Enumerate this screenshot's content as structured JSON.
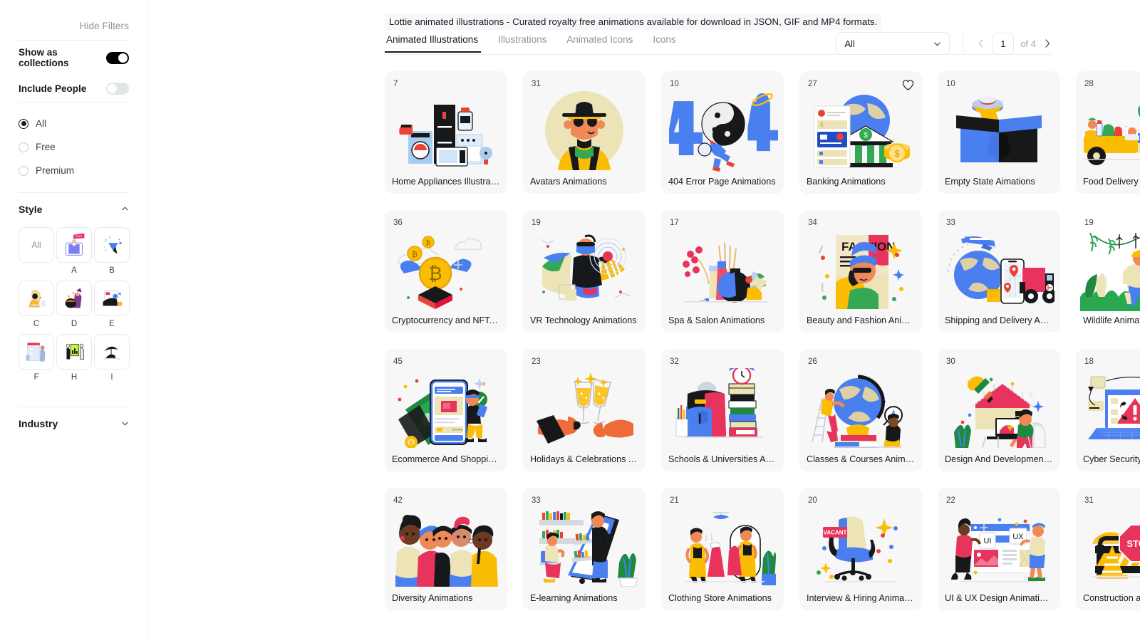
{
  "sidebar": {
    "hide_filters": "Hide Filters",
    "toggles": [
      {
        "label": "Show as collections",
        "state": "on"
      },
      {
        "label": "Include People",
        "state": "off"
      }
    ],
    "price_options": [
      {
        "label": "All",
        "selected": true
      },
      {
        "label": "Free",
        "selected": false
      },
      {
        "label": "Premium",
        "selected": false
      }
    ],
    "style": {
      "title": "Style",
      "chevron": "chevron-up-icon",
      "items": [
        {
          "label": "",
          "thumb": "all",
          "caption": ""
        },
        {
          "label": "A",
          "thumb": "style-a",
          "caption": "A"
        },
        {
          "label": "B",
          "thumb": "style-b",
          "caption": "B"
        },
        {
          "label": "C",
          "thumb": "style-c",
          "caption": "C"
        },
        {
          "label": "D",
          "thumb": "style-d",
          "caption": "D"
        },
        {
          "label": "E",
          "thumb": "style-e",
          "caption": "E"
        },
        {
          "label": "F",
          "thumb": "style-f",
          "caption": "F"
        },
        {
          "label": "H",
          "thumb": "style-h",
          "caption": "H"
        },
        {
          "label": "I",
          "thumb": "style-i",
          "caption": "I"
        }
      ],
      "all_label": "All"
    },
    "industry": {
      "title": "Industry",
      "chevron": "chevron-down-icon"
    }
  },
  "main": {
    "banner": "Lottie animated illustrations - Curated royalty free animations available for download in JSON, GIF and MP4 formats.",
    "tabs": [
      {
        "label": "Animated Illustrations",
        "active": true
      },
      {
        "label": "Illustrations",
        "active": false
      },
      {
        "label": "Animated Icons",
        "active": false
      },
      {
        "label": "Icons",
        "active": false
      }
    ],
    "filter_select": {
      "value": "All",
      "icon": "chevron-down-icon"
    },
    "pagination": {
      "prev_icon": "chevron-left-icon",
      "next_icon": "chevron-right-icon",
      "page": "1",
      "of_label": "of 4"
    }
  },
  "colors": {
    "blue": "#4285f4",
    "yellow": "#fbbc04",
    "red": "#ea4335",
    "green": "#34a853",
    "black": "#17181a",
    "sand": "#e8dcb5",
    "card_bg": "#f7f7f7"
  },
  "cards": [
    {
      "count": "7",
      "title": "Home Appliances Illustrati...",
      "art": "home-appliances",
      "fav": false,
      "bg": "tinted"
    },
    {
      "count": "31",
      "title": "Avatars Animations",
      "art": "avatar",
      "fav": false,
      "bg": "tinted"
    },
    {
      "count": "10",
      "title": "404 Error Page Animations",
      "art": "error-404",
      "fav": false,
      "bg": "tinted"
    },
    {
      "count": "27",
      "title": "Banking Animations",
      "art": "banking",
      "fav": true,
      "bg": "tinted"
    },
    {
      "count": "10",
      "title": "Empty State Aimations",
      "art": "empty-box",
      "fav": false,
      "bg": "tinted"
    },
    {
      "count": "28",
      "title": "Food Delivery Animations",
      "art": "food-delivery",
      "fav": false,
      "bg": "tinted"
    },
    {
      "count": "36",
      "title": "Cryptocurrency and NFTs ...",
      "art": "crypto",
      "fav": false,
      "bg": "tinted"
    },
    {
      "count": "19",
      "title": "VR Technology Animations",
      "art": "vr-tech",
      "fav": false,
      "bg": "tinted"
    },
    {
      "count": "17",
      "title": "Spa & Salon Animations",
      "art": "spa-salon",
      "fav": false,
      "bg": "tinted"
    },
    {
      "count": "34",
      "title": "Beauty and Fashion Anima...",
      "art": "fashion",
      "fav": false,
      "bg": "tinted"
    },
    {
      "count": "33",
      "title": "Shipping and Delivery Ani...",
      "art": "shipping",
      "fav": false,
      "bg": "tinted"
    },
    {
      "count": "19",
      "title": "Wildlife Animations",
      "art": "wildlife",
      "fav": false,
      "bg": "plain"
    },
    {
      "count": "45",
      "title": "Ecommerce And Shopping...",
      "art": "ecommerce",
      "fav": false,
      "bg": "tinted"
    },
    {
      "count": "23",
      "title": "Holidays & Celebrations A...",
      "art": "holidays",
      "fav": false,
      "bg": "tinted"
    },
    {
      "count": "32",
      "title": "Schools & Universities Ani...",
      "art": "schools",
      "fav": false,
      "bg": "tinted"
    },
    {
      "count": "26",
      "title": "Classes & Courses Animati...",
      "art": "classes",
      "fav": false,
      "bg": "tinted"
    },
    {
      "count": "30",
      "title": "Design And Development ...",
      "art": "design-dev",
      "fav": false,
      "bg": "tinted"
    },
    {
      "count": "18",
      "title": "Cyber Security Animations",
      "art": "cyber-security",
      "fav": false,
      "bg": "tinted"
    },
    {
      "count": "42",
      "title": "Diversity Animations",
      "art": "diversity",
      "fav": false,
      "bg": "tinted"
    },
    {
      "count": "33",
      "title": "E-learning Animations",
      "art": "elearning",
      "fav": false,
      "bg": "tinted"
    },
    {
      "count": "21",
      "title": "Clothing Store Animations",
      "art": "clothing-store",
      "fav": false,
      "bg": "tinted"
    },
    {
      "count": "20",
      "title": "Interview & Hiring Animati...",
      "art": "interview",
      "fav": false,
      "bg": "tinted"
    },
    {
      "count": "22",
      "title": "UI & UX Design Animations",
      "art": "ui-ux",
      "fav": false,
      "bg": "tinted"
    },
    {
      "count": "31",
      "title": "Construction and Architec...",
      "art": "construction",
      "fav": false,
      "bg": "tinted"
    }
  ]
}
